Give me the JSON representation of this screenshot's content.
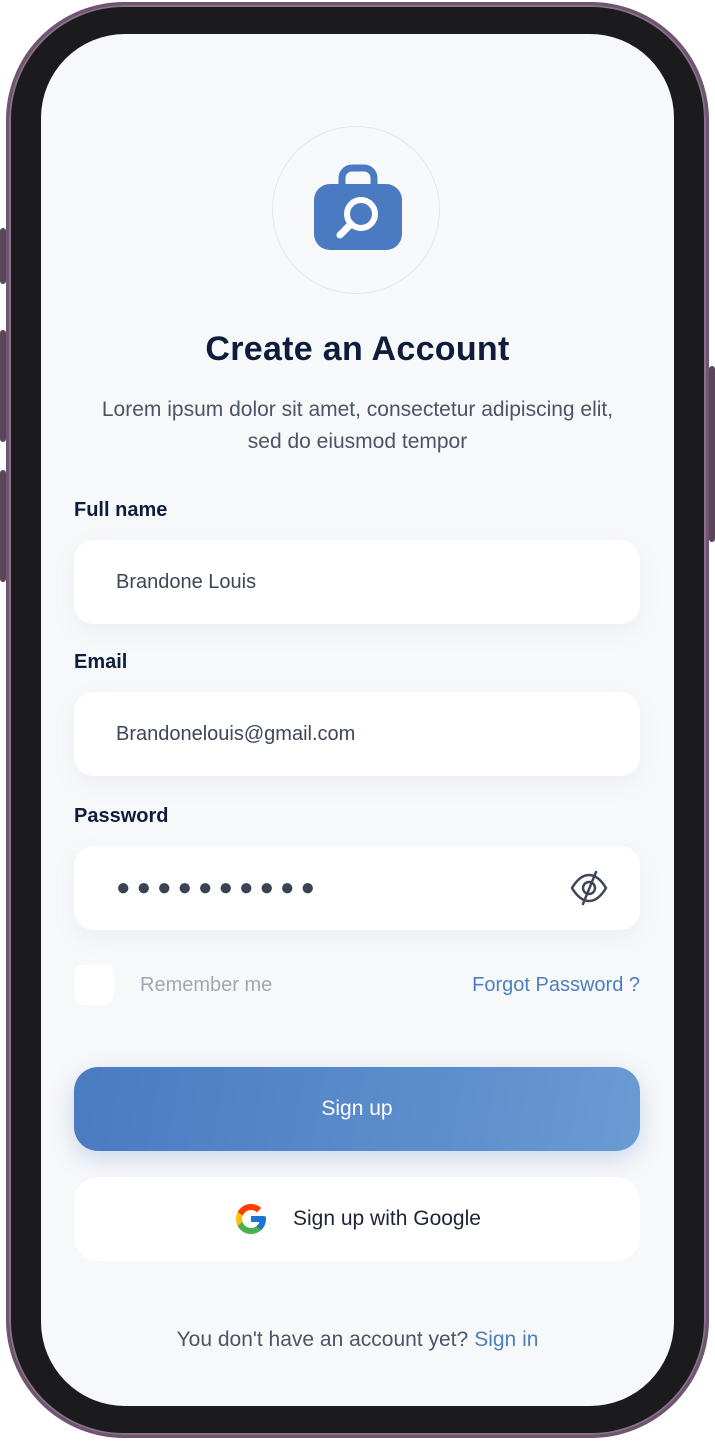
{
  "form": {
    "title": "Create an Account",
    "subtitle": "Lorem ipsum dolor sit amet, consectetur adipiscing elit, sed do eiusmod tempor",
    "full_name": {
      "label": "Full name",
      "value": "Brandone Louis"
    },
    "email": {
      "label": "Email",
      "value": "Brandonelouis@gmail.com"
    },
    "password": {
      "label": "Password",
      "masked_value": "●●●●●●●●●●"
    },
    "remember_label": "Remember me",
    "forgot_label": "Forgot Password ?",
    "signup_label": "Sign up",
    "google_label": "Sign up with Google",
    "footer_text": "You don't have an account yet?",
    "signin_label": "Sign in"
  },
  "icons": {
    "logo": "briefcase-search-icon",
    "password_toggle": "eye-slash-icon",
    "google": "google-icon"
  },
  "colors": {
    "accent": "#4d7fc0",
    "button_start": "#4a7bc2",
    "button_end": "#6a9bd3",
    "title": "#0f1d3b",
    "background": "#f7f8fa",
    "frame": "#6e5670"
  }
}
